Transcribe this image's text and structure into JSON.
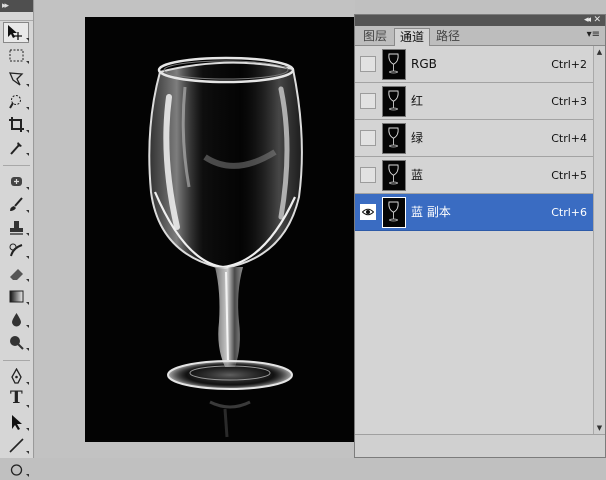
{
  "toolbar": {
    "collapse_glyph": "▸▸",
    "tools": [
      {
        "name": "move-icon"
      },
      {
        "name": "marquee-icon"
      },
      {
        "name": "lasso-icon"
      },
      {
        "name": "quick-select-icon"
      },
      {
        "name": "crop-icon"
      },
      {
        "name": "eyedropper-icon"
      },
      {
        "name": "spot-healing-icon"
      },
      {
        "name": "brush-icon"
      },
      {
        "name": "clone-stamp-icon"
      },
      {
        "name": "history-brush-icon"
      },
      {
        "name": "eraser-icon"
      },
      {
        "name": "gradient-icon"
      },
      {
        "name": "blur-icon"
      },
      {
        "name": "dodge-icon"
      },
      {
        "name": "pen-icon"
      },
      {
        "name": "type-icon"
      },
      {
        "name": "path-select-icon"
      },
      {
        "name": "line-icon"
      }
    ],
    "type_tool_glyph": "T"
  },
  "panel": {
    "collapse_glyph": "◂◂",
    "close_glyph": "✕",
    "menu_glyph": "▾≡",
    "tabs": [
      {
        "label": "图层",
        "active": false
      },
      {
        "label": "通道",
        "active": true
      },
      {
        "label": "路径",
        "active": false
      }
    ],
    "channels": [
      {
        "name": "RGB",
        "shortcut": "Ctrl+2",
        "visible": false,
        "selected": false
      },
      {
        "name": "红",
        "shortcut": "Ctrl+3",
        "visible": false,
        "selected": false
      },
      {
        "name": "绿",
        "shortcut": "Ctrl+4",
        "visible": false,
        "selected": false
      },
      {
        "name": "蓝",
        "shortcut": "Ctrl+5",
        "visible": false,
        "selected": false
      },
      {
        "name": "蓝 副本",
        "shortcut": "Ctrl+6",
        "visible": true,
        "selected": true
      }
    ]
  },
  "colors": {
    "selection": "#3a6cc2",
    "panel_bg": "#d4d4d4",
    "canvas_bg": "#030303"
  }
}
